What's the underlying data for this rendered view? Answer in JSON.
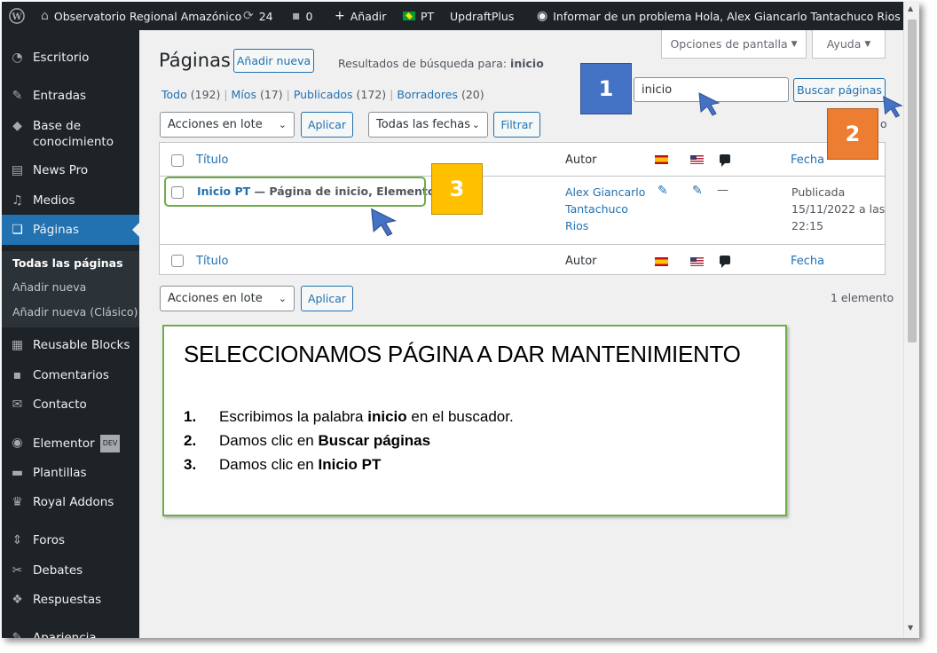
{
  "adminbar": {
    "site_name": "Observatorio Regional Amazónico",
    "updates_count": "24",
    "comments_count": "0",
    "add_label": "Añadir",
    "language": "PT",
    "plugin": "UpdraftPlus",
    "report_problem": "Informar de un problema",
    "greeting": "Hola, Alex Giancarlo Tantachuco Rios"
  },
  "sidebar": {
    "items": [
      {
        "label": "Escritorio",
        "icon": "dashboard-icon"
      },
      {
        "label": "Entradas",
        "icon": "pin-icon"
      },
      {
        "label": "Base de",
        "label2": "conocimiento",
        "icon": "graduation-cap-icon"
      },
      {
        "label": "News Pro",
        "icon": "news-icon"
      },
      {
        "label": "Medios",
        "icon": "media-icon"
      },
      {
        "label": "Páginas",
        "icon": "pages-icon"
      },
      {
        "label": "Reusable Blocks",
        "icon": "blocks-icon"
      },
      {
        "label": "Comentarios",
        "icon": "comment-icon"
      },
      {
        "label": "Contacto",
        "icon": "mail-icon"
      },
      {
        "label": "Elementor",
        "badge": "DEV",
        "icon": "elementor-icon"
      },
      {
        "label": "Plantillas",
        "icon": "folder-icon"
      },
      {
        "label": "Royal Addons",
        "icon": "crown-icon"
      },
      {
        "label": "Foros",
        "icon": "forums-icon"
      },
      {
        "label": "Debates",
        "icon": "debates-icon"
      },
      {
        "label": "Respuestas",
        "icon": "replies-icon"
      },
      {
        "label": "Apariencia",
        "icon": "appearance-icon"
      }
    ],
    "submenu": [
      "Todas las páginas",
      "Añadir nueva",
      "Añadir nueva (Clásico)"
    ]
  },
  "screen_options": "Opciones de pantalla",
  "help": "Ayuda",
  "page": {
    "title": "Páginas",
    "add_new": "Añadir nueva",
    "search_results_prefix": "Resultados de búsqueda para:",
    "search_term": "inicio"
  },
  "filters": {
    "all": "Todo",
    "all_count": "(192)",
    "mine": "Míos",
    "mine_count": "(17)",
    "published": "Publicados",
    "published_count": "(172)",
    "drafts": "Borradores",
    "drafts_count": "(20)"
  },
  "search": {
    "value": "inicio",
    "button": "Buscar páginas"
  },
  "bulk": {
    "actions": "Acciones en lote",
    "apply": "Aplicar",
    "dates": "Todas las fechas",
    "filter": "Filtrar",
    "count_fragment": "o",
    "count": "1 elemento"
  },
  "table": {
    "headers": {
      "title": "Título",
      "author": "Autor",
      "date": "Fecha",
      "no_comments": "—"
    },
    "row": {
      "title": "Inicio PT",
      "suffix": "— Página de inicio, Elementor",
      "author_lines": [
        "Alex Giancarlo",
        "Tantachuco",
        "Rios"
      ],
      "date_lines": [
        "Publicada",
        "15/11/2022 a las",
        "22:15"
      ]
    }
  },
  "annotations": {
    "box1": "1",
    "box2": "2",
    "box3": "3",
    "box1_color": "#4472c4",
    "box2_color": "#ed7d31",
    "box3_color": "#ffc000",
    "outline_color": "#70ad47"
  },
  "callout": {
    "title": "SELECCIONAMOS PÁGINA A DAR MANTENIMIENTO",
    "steps": [
      {
        "n": "1.",
        "pre": "Escribimos la palabra ",
        "bold": "inicio",
        "post": " en el buscador."
      },
      {
        "n": "2.",
        "pre": "Damos clic en ",
        "bold": "Buscar páginas",
        "post": ""
      },
      {
        "n": "3.",
        "pre": "Damos clic en ",
        "bold": "Inicio PT",
        "post": ""
      }
    ]
  }
}
